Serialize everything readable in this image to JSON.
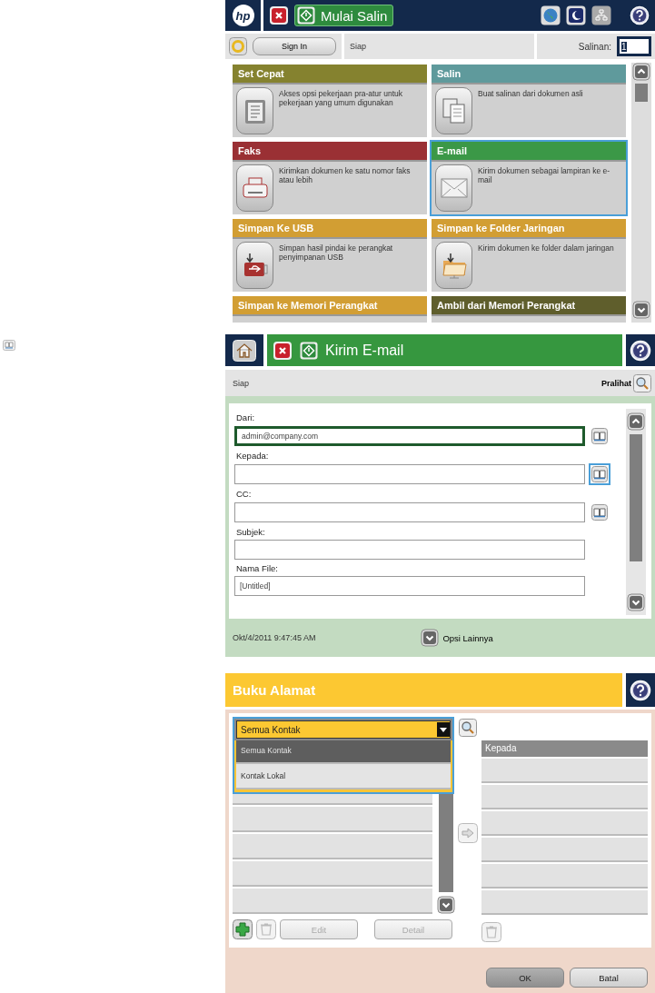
{
  "home_screen": {
    "logo": "hp",
    "start_button": "Mulai Salin",
    "sign_in": "Sign In",
    "status": "Siap",
    "copies_label": "Salinan:",
    "copies_value": "1",
    "tiles": [
      {
        "title": "Set Cepat",
        "description": "Akses opsi pekerjaan pra-atur untuk pekerjaan yang umum digunakan",
        "color": "#85822f",
        "selected": false
      },
      {
        "title": "Salin",
        "description": "Buat salinan dari dokumen asli",
        "color": "#5f9a9c",
        "selected": false
      },
      {
        "title": "Faks",
        "description": "Kirimkan dokumen ke satu nomor faks atau lebih",
        "color": "#9a3034",
        "selected": false
      },
      {
        "title": "E-mail",
        "description": "Kirim dokumen sebagai lampiran ke e-mail",
        "color": "#3b9847",
        "selected": true
      },
      {
        "title": "Simpan Ke USB",
        "description": "Simpan hasil pindai ke perangkat penyimpanan USB",
        "color": "#d29e33",
        "selected": false
      },
      {
        "title": "Simpan ke Folder Jaringan",
        "description": "Kirim dokumen ke folder dalam jaringan",
        "color": "#d29e33",
        "selected": false
      },
      {
        "title": "Simpan ke Memori Perangkat",
        "color": "#d29e33",
        "selected": false
      },
      {
        "title": "Ambil dari Memori Perangkat",
        "color": "#5f5e2c",
        "selected": false
      }
    ]
  },
  "email_screen": {
    "title": "Kirim E-mail",
    "status": "Siap",
    "preview": "Pralihat",
    "fields": [
      {
        "label": "Dari:",
        "value": "admin@company.com",
        "focused": true,
        "address_book": true,
        "highlighted": false
      },
      {
        "label": "Kepada:",
        "focused": false,
        "address_book": true,
        "highlighted": true
      },
      {
        "label": "CC:",
        "focused": false,
        "address_book": true,
        "highlighted": false
      },
      {
        "label": "Subjek:",
        "focused": false,
        "address_book": false
      },
      {
        "label": "Nama File:",
        "value": "[Untitled]",
        "focused": false,
        "address_book": false
      }
    ],
    "datetime": "Okt/4/2011 9:47:45 AM",
    "more_options": "Opsi Lainnya"
  },
  "address_book_screen": {
    "title": "Buku Alamat",
    "contact_filter": "Semua Kontak",
    "filter_highlighted": true,
    "filter_options": [
      {
        "label": "Semua Kontak",
        "selected": true
      },
      {
        "label": "Kontak Lokal",
        "selected": false
      }
    ],
    "recipients_header": "Kepada",
    "buttons": [
      {
        "label": "Edit",
        "disabled": true
      },
      {
        "label": "Detail",
        "disabled": true
      }
    ],
    "actions": [
      {
        "label": "OK",
        "default": true
      },
      {
        "label": "Batal",
        "default": false
      }
    ]
  }
}
